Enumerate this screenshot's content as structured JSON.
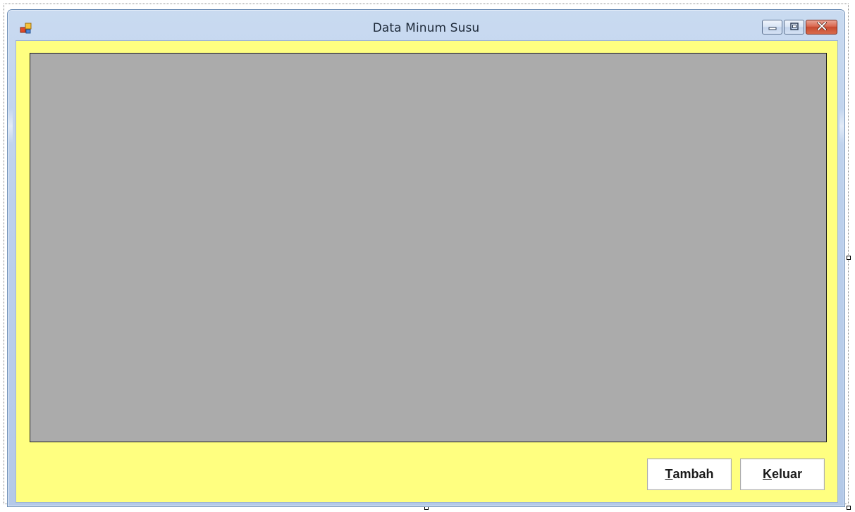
{
  "window": {
    "title": "Data Minum Susu",
    "icon": "form-icon",
    "caption_buttons": [
      "minimize-icon",
      "maximize-icon",
      "close-icon"
    ]
  },
  "form": {
    "background_color": "#ffff80",
    "grid_color": "#ababab"
  },
  "buttons": {
    "tambah": {
      "mnemonic": "T",
      "rest": "ambah"
    },
    "keluar": {
      "mnemonic": "K",
      "rest": "eluar"
    }
  }
}
